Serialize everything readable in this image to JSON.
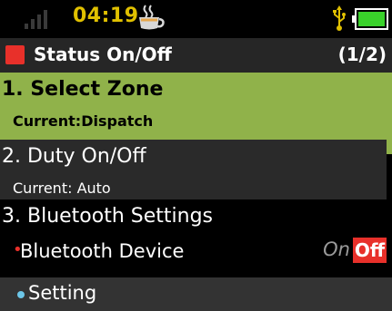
{
  "status_bar": {
    "time": "04:19",
    "icons": {
      "signal": "signal-strength-icon",
      "cup": "coffee-cup-icon",
      "usb": "usb-icon",
      "battery": "battery-icon"
    },
    "colors": {
      "time": "#e0c000",
      "battery_fill": "#39d12a"
    }
  },
  "title_bar": {
    "title": "Status On/Off",
    "page_indicator": "(1/2)",
    "indicator_color": "#e8302a"
  },
  "menu": {
    "items": [
      {
        "title": "1. Select Zone",
        "subtitle": "Current:Dispatch",
        "selected": true
      },
      {
        "title": "2. Duty On/Off",
        "subtitle": "Current: Auto",
        "selected": false
      },
      {
        "title": "3. Bluetooth Settings",
        "selected": false,
        "sub_item": {
          "bullet": "•",
          "label": "Bluetooth Device",
          "on_label": "On",
          "off_label": "Off",
          "state": "Off"
        }
      }
    ],
    "selected_color": "#90b24a"
  },
  "footer": {
    "label": "Setting",
    "dot_color": "#6cc6e8"
  }
}
